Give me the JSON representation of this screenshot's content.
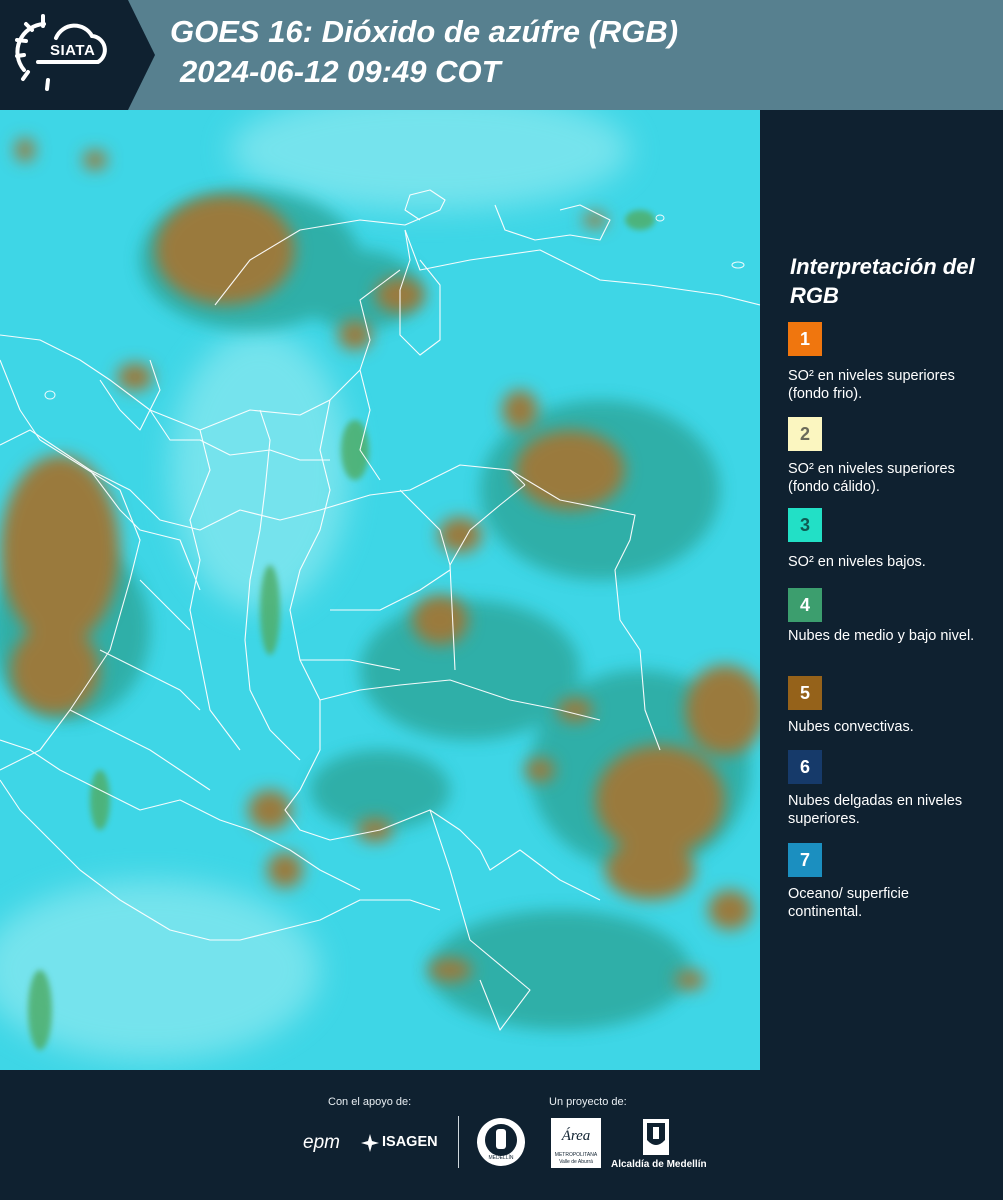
{
  "header": {
    "logo_text": "SIATA",
    "title_line1": "GOES 16: Dióxido de azúfre (RGB)",
    "title_line2": "2024-06-12 09:49 COT"
  },
  "map": {
    "layer": "GOES 16 SO2 RGB composite",
    "colors": {
      "ocean_surface": "#3ed6e6",
      "convective_cloud": "#9a7a3c",
      "mid_low_cloud": "#3f9e86",
      "border": "#ffffff"
    }
  },
  "legend": {
    "title": "Interpretación del RGB",
    "items": [
      {
        "number": "1",
        "color": "#f0760e",
        "text_color": "#ffffff",
        "label": "SO² en niveles superiores (fondo frio)."
      },
      {
        "number": "2",
        "color": "#fbf6c0",
        "text_color": "#6a6a5a",
        "label": "SO² en niveles superiores (fondo cálido)."
      },
      {
        "number": "3",
        "color": "#22e0c6",
        "text_color": "#0f5a52",
        "label": "SO² en niveles bajos."
      },
      {
        "number": "4",
        "color": "#3c9e6e",
        "text_color": "#ffffff",
        "label": "Nubes de medio y bajo nivel."
      },
      {
        "number": "5",
        "color": "#95621a",
        "text_color": "#ffffff",
        "label": "Nubes convectivas."
      },
      {
        "number": "6",
        "color": "#163a6a",
        "text_color": "#ffffff",
        "label": "Nubes delgadas en niveles superiores."
      },
      {
        "number": "7",
        "color": "#1b8fc0",
        "text_color": "#ffffff",
        "label": "Oceano/ superficie continental."
      }
    ]
  },
  "footer": {
    "support_caption": "Con el apoyo de:",
    "project_caption": "Un proyecto de:",
    "sponsors": [
      "epm",
      "ISAGEN"
    ],
    "partners": [
      "Área Metropolitana Valle de Aburrá",
      "Alcaldía de Medellín"
    ],
    "area_name": "Área",
    "area_sub1": "METROPOLITANA",
    "area_sub2": "Valle de Aburrá",
    "alcaldia_label": "Alcaldía de Medellín",
    "seal_label": "MEDELLÍN"
  }
}
